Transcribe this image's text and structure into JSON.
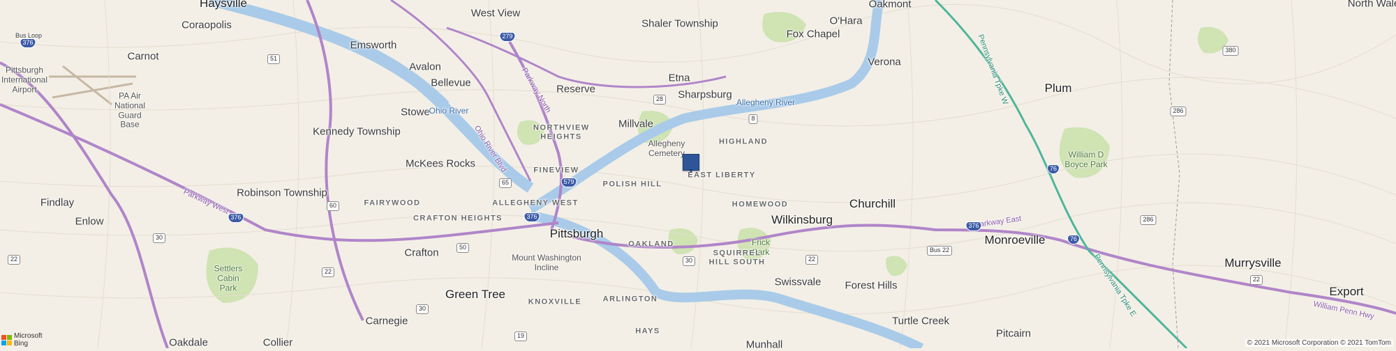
{
  "map": {
    "colors": {
      "land": "#f3efe6",
      "water": "#a9cbe9",
      "park": "#cfe3b3",
      "highway": "#b085c9",
      "road": "#fffaf0",
      "marker": "#2e5597"
    },
    "towns": [
      "Haysville",
      "Coraopolis",
      "Carnot",
      "Emsworth",
      "West View",
      "Shaler Township",
      "Fox Chapel",
      "O'Hara",
      "Oakmont",
      "Verona",
      "North Wale",
      "Avalon",
      "Bellevue",
      "Reserve",
      "Etna",
      "Sharpsburg",
      "Allegheny River",
      "Plum",
      "Stowe",
      "Ohio River",
      "Millvale",
      "Kennedy Township",
      "McKees Rocks",
      "Robinson Township",
      "Findlay",
      "Enlow",
      "Pittsburgh",
      "Wilkinsburg",
      "Churchill",
      "Monroeville",
      "Crafton",
      "Mount Washington Incline",
      "Frick Park",
      "Swissvale",
      "Forest Hills",
      "Murrysville",
      "Export",
      "Green Tree",
      "Carnegie",
      "Turtle Creek",
      "Pitcairn",
      "Oakdale",
      "Collier",
      "Munhall",
      "Allegheny Cemetery",
      "Settlers Cabin Park",
      "William D Boyce Park",
      "PA Air National Guard Base",
      "Pittsburgh International Airport",
      "Bus Loop"
    ],
    "neighborhoods": [
      "NORTHVIEW HEIGHTS",
      "HIGHLAND",
      "FINEVIEW",
      "POLISH HILL",
      "EAST LIBERTY",
      "FAIRYWOOD",
      "ALLEGHENY WEST",
      "CRAFTON HEIGHTS",
      "HOMEWOOD",
      "OAKLAND",
      "SQUIRREL HILL SOUTH",
      "KNOXVILLE",
      "ARLINGTON",
      "HAYS"
    ],
    "roads": [
      "Parkway North",
      "Ohio River Blvd",
      "Parkway West",
      "Parkway East",
      "Pennsylvania Tpke W",
      "Pennsylvania Tpke E",
      "William Penn Hwy"
    ],
    "shields": [
      "376",
      "279",
      "579",
      "65",
      "51",
      "28",
      "8",
      "60",
      "30",
      "22",
      "50",
      "19",
      "22",
      "286",
      "380",
      "286",
      "76",
      "376",
      "Bus 22",
      "Trk 19"
    ],
    "marker": {
      "label": "selected-location-pin"
    }
  },
  "branding": {
    "logo_line1": "Microsoft",
    "logo_line2": "Bing"
  },
  "copyright": "© 2021 Microsoft Corporation © 2021 TomTom"
}
